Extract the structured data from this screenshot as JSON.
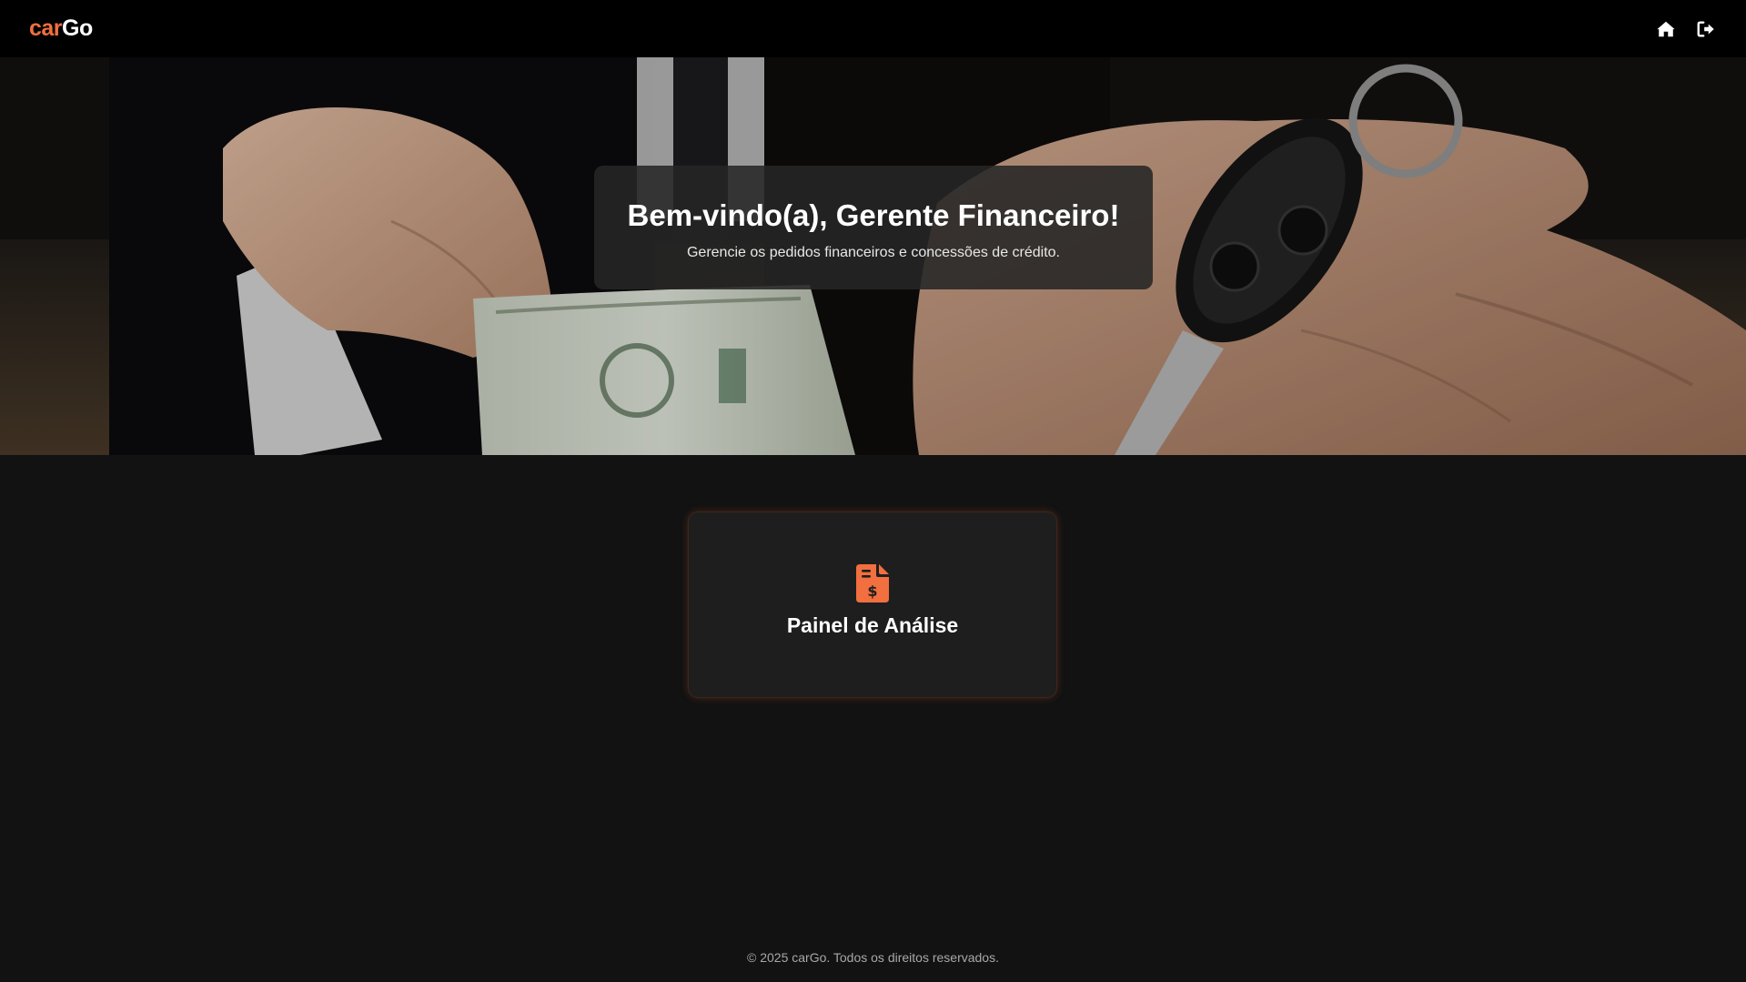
{
  "navbar": {
    "logo_car": "car",
    "logo_go": "Go",
    "icons": [
      "home-icon",
      "logout-icon"
    ]
  },
  "hero": {
    "title": "Bem-vindo(a), Gerente Financeiro!",
    "subtitle": "Gerencie os pedidos financeiros e concessões de crédito."
  },
  "card": {
    "label": "Painel de Análise",
    "icon": "file-invoice-dollar-icon"
  },
  "footer": {
    "text": "© 2025 carGo. Todos os direitos reservados."
  },
  "colors": {
    "accent": "#f26f3f",
    "background": "#121212",
    "card": "#1e1e1e",
    "navbar": "#000000"
  }
}
